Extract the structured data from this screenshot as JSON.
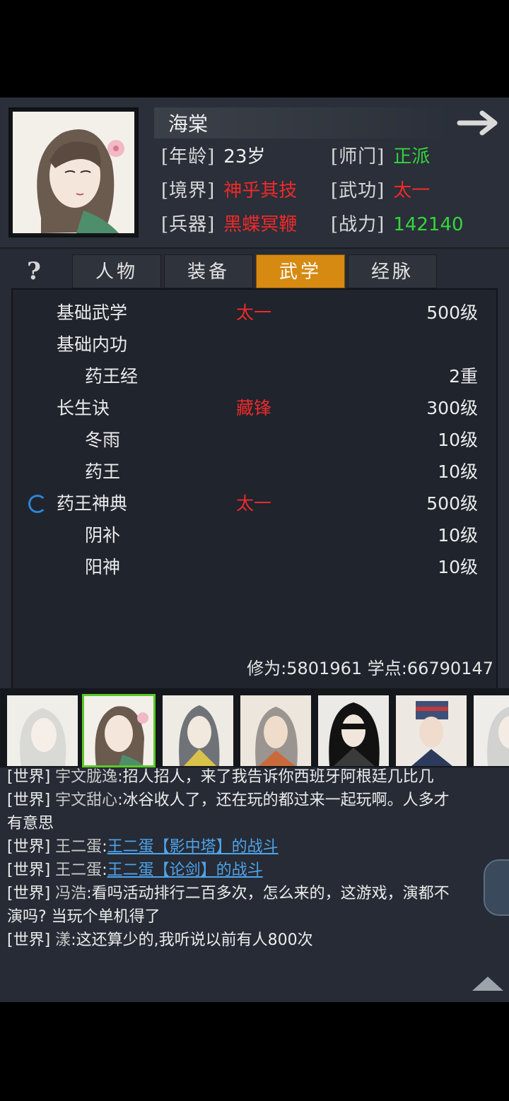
{
  "character": {
    "name": "海棠",
    "stats": [
      {
        "label": "[年龄]",
        "value": "23岁",
        "color": "#f0f0f0"
      },
      {
        "label": "[师门]",
        "value": "正派",
        "color": "#34d63c"
      },
      {
        "label": "[境界]",
        "value": "神乎其技",
        "color": "#ee2a2a"
      },
      {
        "label": "[武功]",
        "value": "太一",
        "color": "#ee2a2a"
      },
      {
        "label": "[兵器]",
        "value": "黑蝶冥鞭",
        "color": "#ee2a2a"
      },
      {
        "label": "[战力]",
        "value": "142140",
        "color": "#34d63c"
      }
    ]
  },
  "tabs": [
    {
      "label": "人物",
      "active": false
    },
    {
      "label": "装备",
      "active": false
    },
    {
      "label": "武学",
      "active": true
    },
    {
      "label": "经脉",
      "active": false
    }
  ],
  "help_icon": "?",
  "skills": [
    {
      "name": "基础武学",
      "tag": "太一",
      "level": "500级",
      "indent": 0
    },
    {
      "name": "基础内功",
      "tag": "",
      "level": "",
      "indent": 0
    },
    {
      "name": "药王经",
      "tag": "",
      "level": "2重",
      "indent": 1
    },
    {
      "name": "长生诀",
      "tag": "藏锋",
      "level": "300级",
      "indent": 0
    },
    {
      "name": "冬雨",
      "tag": "",
      "level": "10级",
      "indent": 1
    },
    {
      "name": "药王",
      "tag": "",
      "level": "10级",
      "indent": 1
    },
    {
      "name": "药王神典",
      "tag": "太一",
      "level": "500级",
      "indent": 0,
      "active": true
    },
    {
      "name": "阴补",
      "tag": "",
      "level": "10级",
      "indent": 1
    },
    {
      "name": "阳神",
      "tag": "",
      "level": "10级",
      "indent": 1
    }
  ],
  "cultivation": "修为:5801961 学点:66790147",
  "roster_count": 7,
  "roster_selected": 1,
  "chat": [
    {
      "channel": "[世界]",
      "speaker": "宇文胧逸",
      "text": ":招人招人，来了我告诉你西班牙阿根廷几比几",
      "link": ""
    },
    {
      "channel": "[世界]",
      "speaker": "宇文甜心",
      "text": ":冰谷收人了，还在玩的都过来一起玩啊。人多才",
      "link": ""
    },
    {
      "channel": "",
      "speaker": "",
      "text": "有意思",
      "link": ""
    },
    {
      "channel": "[世界]",
      "speaker": "王二蛋",
      "text": ":",
      "link": "王二蛋【影中塔】的战斗"
    },
    {
      "channel": "[世界]",
      "speaker": "王二蛋",
      "text": ":",
      "link": "王二蛋【论剑】的战斗"
    },
    {
      "channel": "[世界]",
      "speaker": "冯浩",
      "text": ":看吗活动排行二百多次，怎么来的，这游戏，演都不",
      "link": ""
    },
    {
      "channel": "",
      "speaker": "",
      "text": "演吗? 当玩个单机得了",
      "link": ""
    },
    {
      "channel": "[世界]",
      "speaker": "漾",
      "text": ":这还算少的,我听说以前有人800次",
      "link": ""
    }
  ]
}
